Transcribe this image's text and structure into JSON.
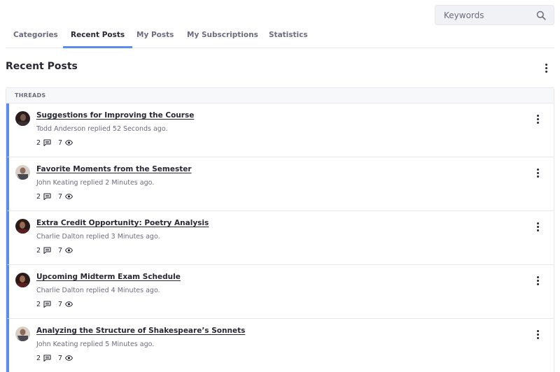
{
  "search": {
    "placeholder": "Keywords",
    "icon": "search-icon"
  },
  "tabs": [
    {
      "label": "Categories",
      "active": false
    },
    {
      "label": "Recent Posts",
      "active": true
    },
    {
      "label": "My Posts",
      "active": false
    },
    {
      "label": "My Subscriptions",
      "active": false
    },
    {
      "label": "Statistics",
      "active": false
    }
  ],
  "page": {
    "title": "Recent Posts"
  },
  "panel": {
    "header": "THREADS"
  },
  "threads": [
    {
      "title": "Suggestions for Improving the Course",
      "meta": "Todd Anderson replied 52 Seconds ago.",
      "replies": "2",
      "views": "7"
    },
    {
      "title": "Favorite Moments from the Semester",
      "meta": "John Keating replied 2 Minutes ago.",
      "replies": "2",
      "views": "7"
    },
    {
      "title": "Extra Credit Opportunity: Poetry Analysis",
      "meta": "Charlie Dalton replied 3 Minutes ago.",
      "replies": "2",
      "views": "7"
    },
    {
      "title": "Upcoming Midterm Exam Schedule",
      "meta": "Charlie Dalton replied 4 Minutes ago.",
      "replies": "2",
      "views": "7"
    },
    {
      "title": "Analyzing the Structure of Shakespeare’s Sonnets",
      "meta": "John Keating replied 5 Minutes ago.",
      "replies": "2",
      "views": "7"
    }
  ],
  "colors": {
    "accent": "#5b8def",
    "text": "#272833",
    "muted": "#6b6c7e",
    "border": "#e7e7ed"
  }
}
